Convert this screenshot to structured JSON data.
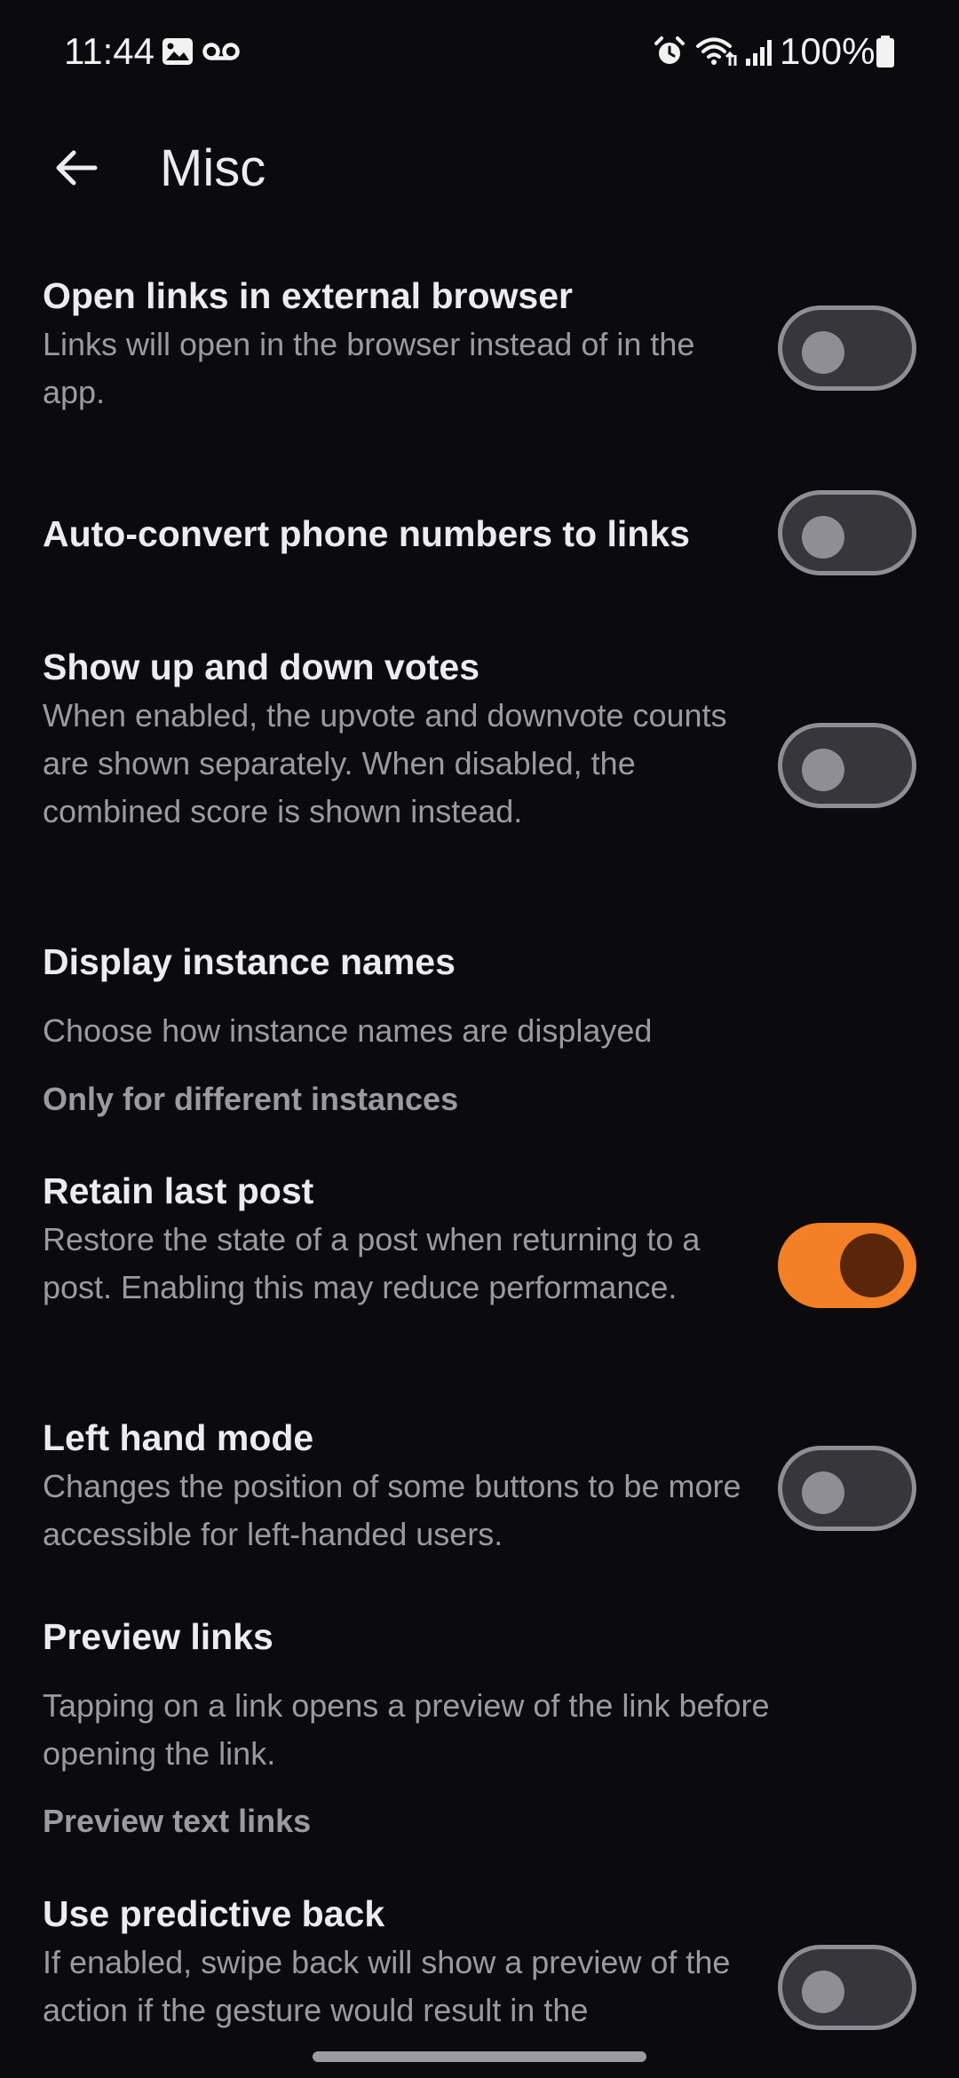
{
  "status_bar": {
    "time": "11:44",
    "battery": "100%",
    "icons": [
      "image-icon",
      "voicemail-icon",
      "alarm-icon",
      "wifi-icon",
      "signal-icon",
      "battery-icon"
    ]
  },
  "app_bar": {
    "title": "Misc",
    "back_icon": "arrow-left-icon"
  },
  "settings": [
    {
      "title": "Open links in external browser",
      "description": "Links will open in the browser instead of in the app.",
      "toggle_on": false
    },
    {
      "title": "Auto-convert phone numbers to links",
      "toggle_on": false
    },
    {
      "title": "Show up and down votes",
      "description": "When enabled, the upvote and downvote counts are shown separately. When disabled, the combined score is shown instead.",
      "toggle_on": false
    },
    {
      "title": "Display instance names",
      "description": "Choose how instance names are displayed",
      "value": "Only for different instances"
    },
    {
      "title": "Retain last post",
      "description": "Restore the state of a post when returning to a post. Enabling this may reduce performance.",
      "toggle_on": true
    },
    {
      "title": "Left hand mode",
      "description": "Changes the position of some buttons to be more accessible for left-handed users.",
      "toggle_on": false
    },
    {
      "title": "Preview links",
      "description": "Tapping on a link opens a preview of the link before opening the link.",
      "value": "Preview text links"
    },
    {
      "title": "Use predictive back",
      "description": "If enabled, swipe back will show a preview of the action if the gesture would result in the",
      "toggle_on": false
    }
  ],
  "colors": {
    "background": "#0b0b0d",
    "accent": "#f48026",
    "toggle_on_knob": "#5a2609",
    "toggle_off_track": "#37373b",
    "toggle_off_outline": "#8e8e94",
    "secondary_text": "#9a9aa0"
  }
}
